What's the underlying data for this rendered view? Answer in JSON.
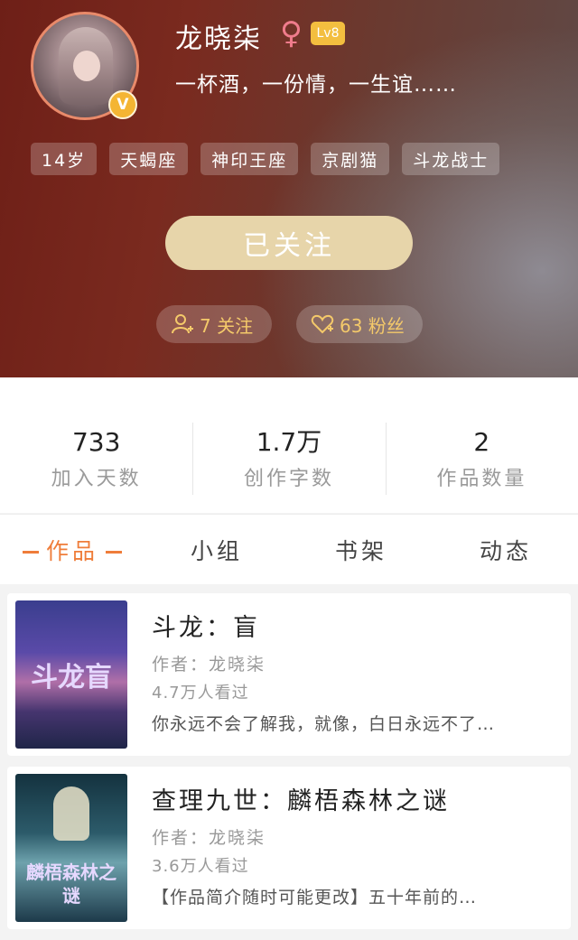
{
  "profile": {
    "username": "龙晓柒",
    "gender_symbol": "♀",
    "level": "Lv8",
    "verified_symbol": "V",
    "bio": "一杯酒，一份情，一生谊……",
    "tags": [
      "14岁",
      "天蝎座",
      "神印王座",
      "京剧猫",
      "斗龙战士"
    ],
    "follow_button_label": "已关注",
    "following_label": "7 关注",
    "followers_label": "63 粉丝"
  },
  "stats": [
    {
      "value": "733",
      "label": "加入天数"
    },
    {
      "value": "1.7万",
      "label": "创作字数"
    },
    {
      "value": "2",
      "label": "作品数量"
    }
  ],
  "tabs": [
    "作品",
    "小组",
    "书架",
    "动态"
  ],
  "works": [
    {
      "title": "斗龙：盲",
      "author": "作者：龙晓柒",
      "views": "4.7万人看过",
      "description": "你永远不会了解我，就像，白日永远不了…",
      "cover_text": "斗龙盲"
    },
    {
      "title": "查理九世：麟梧森林之谜",
      "author": "作者：龙晓柒",
      "views": "3.6万人看过",
      "description": "【作品简介随时可能更改】五十年前的…",
      "cover_text": "麟梧森林之谜"
    }
  ],
  "colors": {
    "accent": "#ef7d3a",
    "follow_button": "#e7d5aa",
    "level_badge": "#f3be3f",
    "gender": "#f07c8c"
  }
}
